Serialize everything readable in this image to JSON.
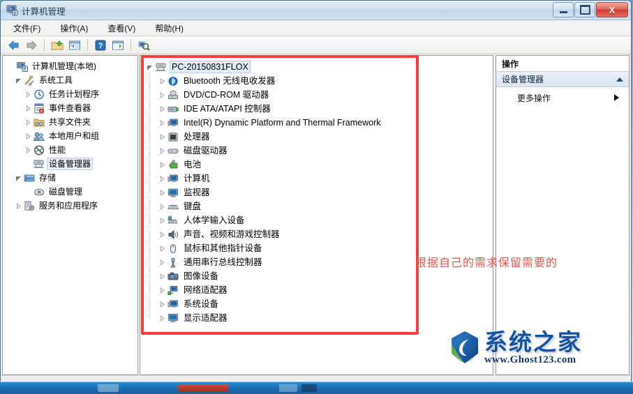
{
  "window": {
    "title": "计算机管理",
    "icon": "computer-management-icon",
    "buttons": {
      "minimize": "–",
      "maximize": "□",
      "close": "X"
    }
  },
  "menubar": [
    {
      "label": "文件(F)",
      "name": "menu-file"
    },
    {
      "label": "操作(A)",
      "name": "menu-action"
    },
    {
      "label": "查看(V)",
      "name": "menu-view"
    },
    {
      "label": "帮助(H)",
      "name": "menu-help"
    }
  ],
  "toolbar": [
    {
      "name": "back-icon"
    },
    {
      "name": "forward-icon"
    },
    {
      "name": "up-folder-icon"
    },
    {
      "name": "show-hide-console-tree-icon"
    },
    {
      "name": "help-icon"
    },
    {
      "name": "show-hide-action-pane-icon"
    },
    {
      "name": "scan-hardware-changes-icon"
    }
  ],
  "sidebar": {
    "items": [
      {
        "label": "计算机管理(本地)",
        "icon": "computer-icon",
        "indent": 0,
        "expander": "none",
        "selected": false
      },
      {
        "label": "系统工具",
        "icon": "tools-icon",
        "indent": 1,
        "expander": "expanded",
        "selected": false
      },
      {
        "label": "任务计划程序",
        "icon": "clock-icon",
        "indent": 2,
        "expander": "collapsed",
        "selected": false
      },
      {
        "label": "事件查看器",
        "icon": "event-viewer-icon",
        "indent": 2,
        "expander": "collapsed",
        "selected": false
      },
      {
        "label": "共享文件夹",
        "icon": "shared-folder-icon",
        "indent": 2,
        "expander": "collapsed",
        "selected": false
      },
      {
        "label": "本地用户和组",
        "icon": "users-icon",
        "indent": 2,
        "expander": "collapsed",
        "selected": false
      },
      {
        "label": "性能",
        "icon": "performance-icon",
        "indent": 2,
        "expander": "collapsed",
        "selected": false
      },
      {
        "label": "设备管理器",
        "icon": "device-manager-icon",
        "indent": 2,
        "expander": "none",
        "selected": true
      },
      {
        "label": "存储",
        "icon": "storage-icon",
        "indent": 1,
        "expander": "expanded",
        "selected": false
      },
      {
        "label": "磁盘管理",
        "icon": "disk-management-icon",
        "indent": 2,
        "expander": "none",
        "selected": false
      },
      {
        "label": "服务和应用程序",
        "icon": "services-icon",
        "indent": 1,
        "expander": "collapsed",
        "selected": false
      }
    ]
  },
  "device_tree": {
    "root": {
      "label": "PC-20150831FLOX",
      "icon": "computer-node-icon",
      "expander": "expanded",
      "selected": true
    },
    "items": [
      {
        "label": "Bluetooth 无线电收发器",
        "icon": "bluetooth-icon"
      },
      {
        "label": "DVD/CD-ROM 驱动器",
        "icon": "dvd-drive-icon"
      },
      {
        "label": "IDE ATA/ATAPI 控制器",
        "icon": "ide-controller-icon"
      },
      {
        "label": "Intel(R) Dynamic Platform and Thermal Framework",
        "icon": "system-device-icon"
      },
      {
        "label": "处理器",
        "icon": "processor-icon"
      },
      {
        "label": "磁盘驱动器",
        "icon": "disk-drive-icon"
      },
      {
        "label": "电池",
        "icon": "battery-icon"
      },
      {
        "label": "计算机",
        "icon": "computer-device-icon"
      },
      {
        "label": "监视器",
        "icon": "monitor-icon"
      },
      {
        "label": "键盘",
        "icon": "keyboard-icon"
      },
      {
        "label": "人体学输入设备",
        "icon": "hid-icon"
      },
      {
        "label": "声音、视频和游戏控制器",
        "icon": "sound-icon"
      },
      {
        "label": "鼠标和其他指针设备",
        "icon": "mouse-icon"
      },
      {
        "label": "通用串行总线控制器",
        "icon": "usb-icon"
      },
      {
        "label": "图像设备",
        "icon": "imaging-device-icon"
      },
      {
        "label": "网络适配器",
        "icon": "network-adapter-icon"
      },
      {
        "label": "系统设备",
        "icon": "system-device-icon"
      },
      {
        "label": "显示适配器",
        "icon": "display-adapter-icon"
      }
    ]
  },
  "actions_pane": {
    "header": "操作",
    "group": "设备管理器",
    "items": [
      {
        "label": "更多操作",
        "name": "more-actions"
      }
    ]
  },
  "annotation": {
    "text": "根据自己的需求保留需要的",
    "color": "#e8564e",
    "rect_color": "#f2413a"
  },
  "watermark": {
    "name": "系统之家",
    "url": "www.Ghost123.com"
  },
  "statusbar": {
    "text": ""
  }
}
